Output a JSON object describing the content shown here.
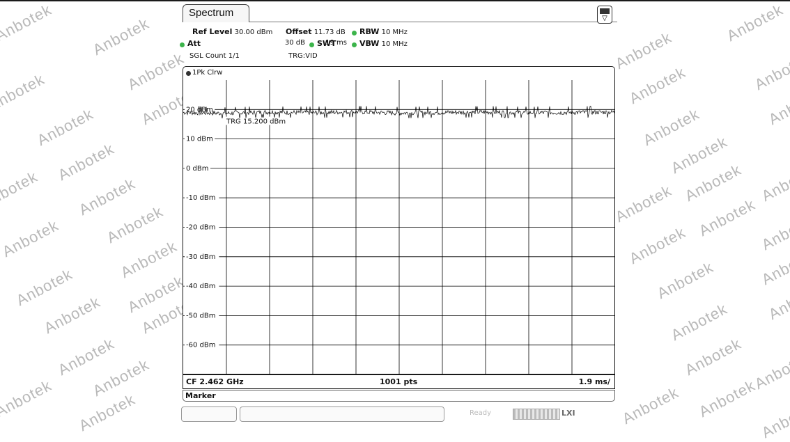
{
  "tab": {
    "title": "Spectrum"
  },
  "settings": {
    "ref_level_label": "Ref Level",
    "ref_level_value": "30.00 dBm",
    "offset_label": "Offset",
    "offset_value": "11.73 dB",
    "rbw_label": "RBW",
    "rbw_value": "10 MHz",
    "att_label": "Att",
    "att_value": "30 dB",
    "swt_label": "SWT",
    "swt_value": "19 ms",
    "vbw_label": "VBW",
    "vbw_value": "10 MHz",
    "sgl_count": "SGL Count 1/1",
    "trigger": "TRG:VID"
  },
  "trace": {
    "label": "1Pk Clrw"
  },
  "trigger_line": {
    "label": "TRG  15.200 dBm",
    "level_dbm": 15.2
  },
  "footer": {
    "center_freq": "CF 2.462 GHz",
    "points": "1001 pts",
    "span": "1.9 ms/"
  },
  "marker_panel": {
    "label": "Marker"
  },
  "status": {
    "state": "Ready"
  },
  "colors": {
    "indicator": "#3cb44b",
    "trace": "#000000",
    "grid": "#000000"
  },
  "watermark": "Anbotek",
  "chart_data": {
    "type": "line",
    "title": "",
    "xlabel": "",
    "ylabel": "",
    "ylim": [
      -70,
      30
    ],
    "xlim": [
      0,
      19
    ],
    "y_ticks": [
      "20 dBm",
      "10 dBm",
      "0 dBm",
      "-10 dBm",
      "-20 dBm",
      "-30 dBm",
      "-40 dBm",
      "-50 dBm",
      "-60 dBm"
    ],
    "y_tick_values": [
      20,
      10,
      0,
      -10,
      -20,
      -30,
      -40,
      -50,
      -60
    ],
    "grid": true,
    "series": [
      {
        "x": [
          0,
          1.9,
          3.8,
          5.7,
          7.6,
          9.5,
          11.4,
          13.3,
          15.2,
          17.1,
          19.0
        ],
        "y": [
          19.0,
          18.7,
          19.1,
          18.9,
          19.2,
          18.8,
          19.0,
          19.1,
          18.9,
          19.0,
          19.1
        ]
      }
    ]
  }
}
